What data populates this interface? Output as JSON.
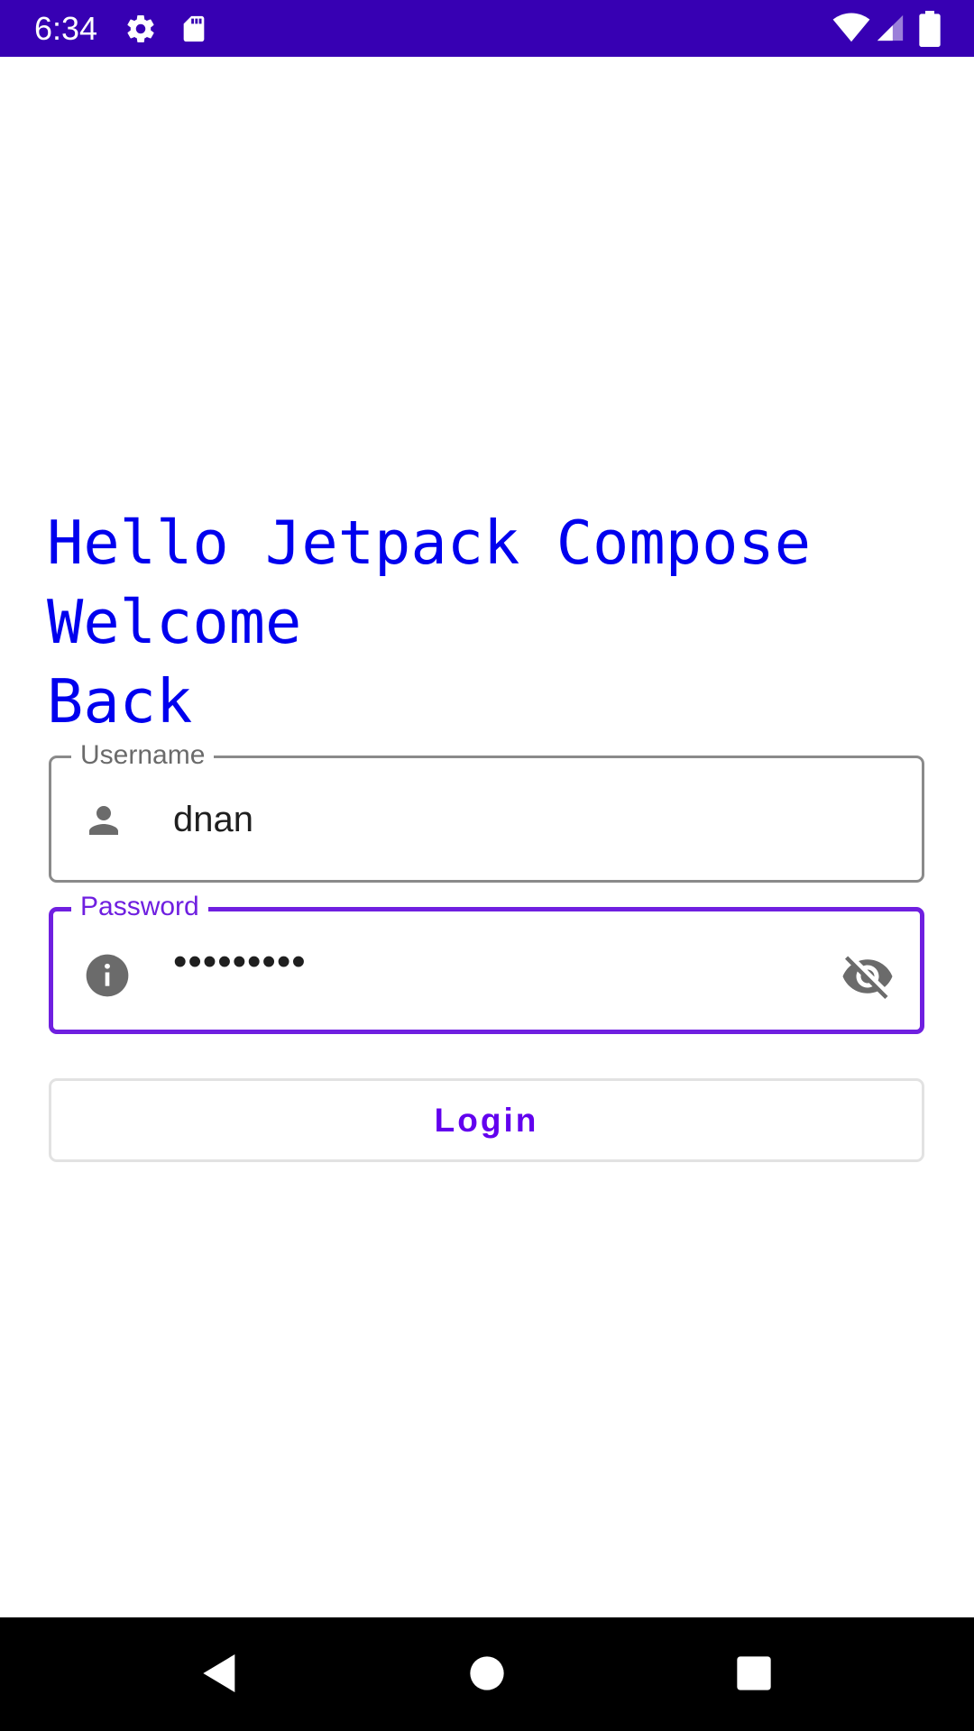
{
  "status_bar": {
    "time": "6:34",
    "icons": [
      "gear-icon",
      "sd-card-icon",
      "wifi-icon",
      "cellular-signal-icon",
      "battery-icon"
    ],
    "background": "#3700b3"
  },
  "content": {
    "headline": "Hello Jetpack Compose\nWelcome\nBack",
    "headline_color": "#0000ee"
  },
  "username_field": {
    "label": "Username",
    "value": "dnan",
    "leading_icon": "person-icon"
  },
  "password_field": {
    "label": "Password",
    "value": "•••••••••",
    "leading_icon": "info-icon",
    "trailing_icon": "visibility-off-icon",
    "accent": "#6f1fe0"
  },
  "login_button": {
    "label": "Login",
    "color": "#6200ee"
  },
  "nav_bar": {
    "buttons": [
      "back-icon",
      "home-icon",
      "recents-icon"
    ]
  }
}
